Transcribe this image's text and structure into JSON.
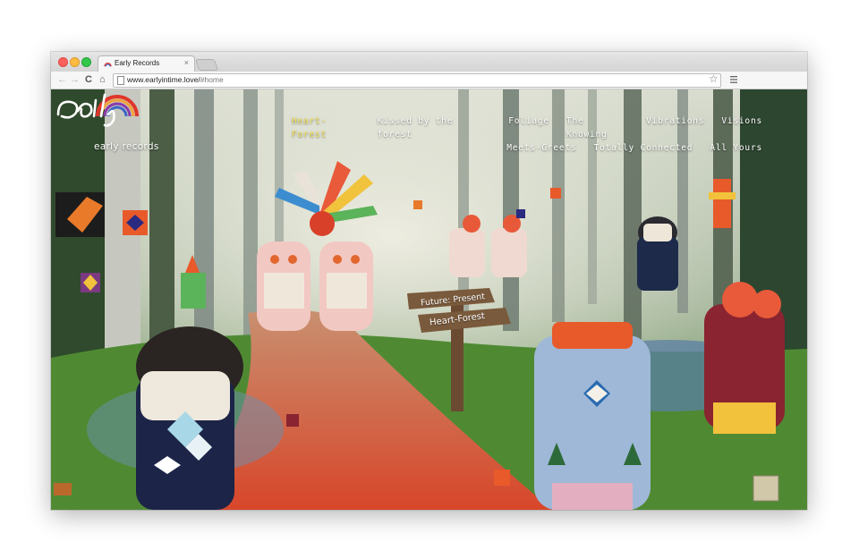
{
  "browser": {
    "tab_title": "Early Records",
    "tab_close": "×",
    "url_host": "www.earlyintime.love/",
    "url_path": "#home",
    "nav_back": "←",
    "nav_forward": "→",
    "nav_reload": "C",
    "nav_home": "⌂",
    "bookmark_star": "☆"
  },
  "site": {
    "logo_tagline": "early records",
    "menu_row1": [
      "Heart-Forest",
      "Kissed by the forest",
      "Foliage",
      "The Knowing",
      "Vibrations",
      "Visions"
    ],
    "menu_row2": [
      "Meets-Greets",
      "Totally Connected",
      "All Yours"
    ],
    "active_item": "Heart-Forest",
    "signpost_top": "Future: Present",
    "signpost_bottom": "Heart-Forest"
  },
  "colors": {
    "active_menu": "#f7e25a",
    "menu_text": "#ffffff"
  }
}
